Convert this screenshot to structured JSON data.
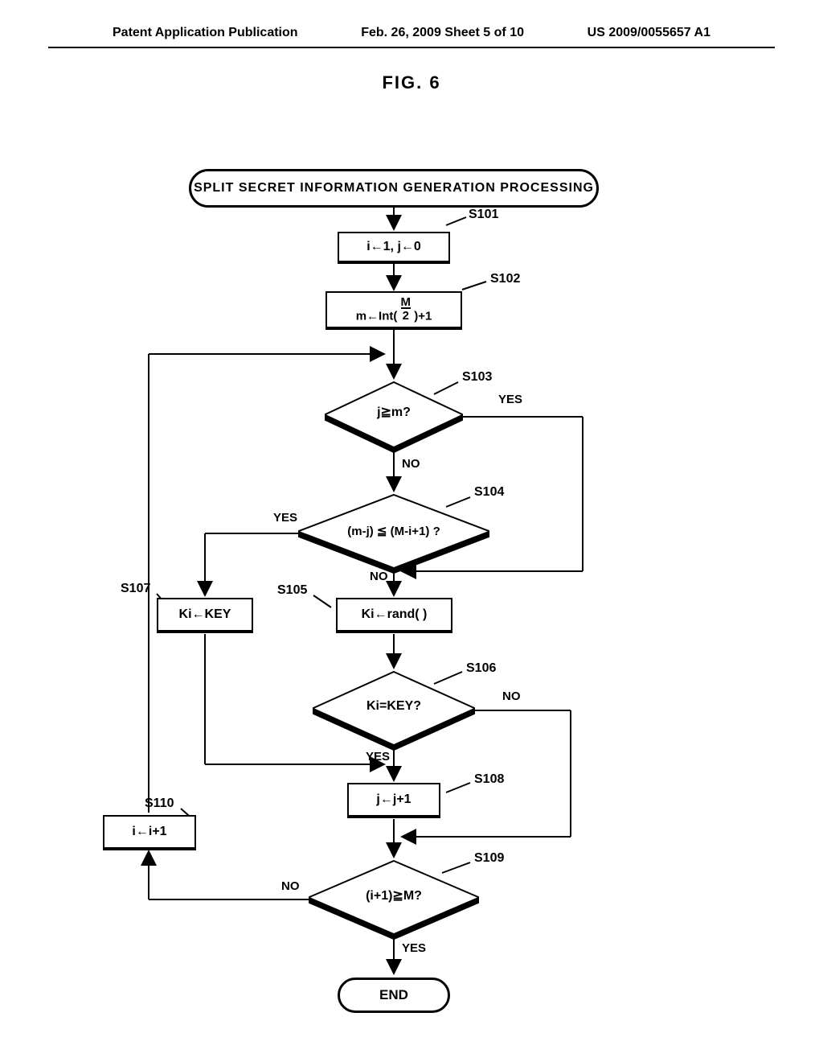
{
  "header": {
    "left": "Patent Application Publication",
    "center": "Feb. 26, 2009  Sheet 5 of 10",
    "right": "US 2009/0055657 A1"
  },
  "figure_title": "FIG. 6",
  "flowchart": {
    "start": "SPLIT SECRET INFORMATION GENERATION PROCESSING",
    "s101": {
      "label": "S101",
      "text": "i←1, j←0"
    },
    "s102": {
      "label": "S102",
      "text": "m←Int( M/2 )+1"
    },
    "s103": {
      "label": "S103",
      "text": "j≧m?",
      "yes": "YES",
      "no": "NO"
    },
    "s104": {
      "label": "S104",
      "text": "(m-j) ≦ (M-i+1) ?",
      "yes": "YES",
      "no": "NO"
    },
    "s105": {
      "label": "S105",
      "text": "Ki←rand( )"
    },
    "s106": {
      "label": "S106",
      "text": "Ki=KEY?",
      "yes": "YES",
      "no": "NO"
    },
    "s107": {
      "label": "S107",
      "text": "Ki←KEY"
    },
    "s108": {
      "label": "S108",
      "text": "j←j+1"
    },
    "s109": {
      "label": "S109",
      "text": "(i+1)≧M?",
      "yes": "YES",
      "no": "NO"
    },
    "s110": {
      "label": "S110",
      "text": "i←i+1"
    },
    "end": "END"
  }
}
